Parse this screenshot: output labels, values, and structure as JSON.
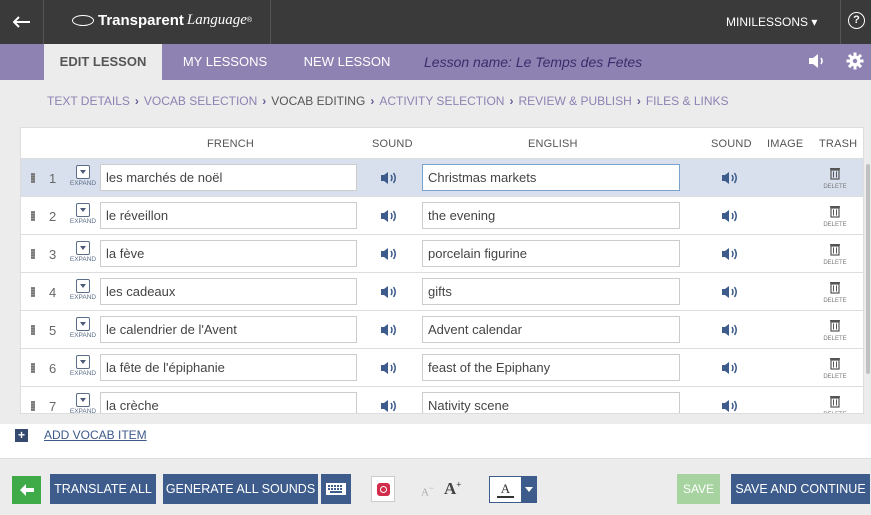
{
  "topbar": {
    "brand_bold": "Transparent",
    "brand_italic": "Language",
    "brand_mark": "®",
    "menu_label": "MINILESSONS",
    "menu_caret": "▾",
    "help_label": "?"
  },
  "tabs": [
    {
      "label": "EDIT LESSON",
      "active": true
    },
    {
      "label": "MY LESSONS",
      "active": false
    },
    {
      "label": "NEW LESSON",
      "active": false
    }
  ],
  "lesson_name": "Lesson name: Le Temps des Fetes",
  "breadcrumbs": [
    {
      "label": "TEXT DETAILS",
      "current": false
    },
    {
      "label": "VOCAB SELECTION",
      "current": false
    },
    {
      "label": "VOCAB EDITING",
      "current": true
    },
    {
      "label": "ACTIVITY SELECTION",
      "current": false
    },
    {
      "label": "REVIEW & PUBLISH",
      "current": false
    },
    {
      "label": "FILES & LINKS",
      "current": false
    }
  ],
  "breadcrumb_separator": "›",
  "table": {
    "headers": {
      "french": "FRENCH",
      "sound1": "SOUND",
      "english": "ENGLISH",
      "sound2": "SOUND",
      "image": "IMAGE",
      "trash": "TRASH"
    },
    "expand_label": "EXPAND",
    "delete_label": "DELETE",
    "rows": [
      {
        "num": "1",
        "french": "les marchés de noël",
        "english": "Christmas markets",
        "selected": true
      },
      {
        "num": "2",
        "french": "le réveillon",
        "english": "the evening",
        "selected": false
      },
      {
        "num": "3",
        "french": "la fève",
        "english": "porcelain figurine",
        "selected": false
      },
      {
        "num": "4",
        "french": "les cadeaux",
        "english": "gifts",
        "selected": false
      },
      {
        "num": "5",
        "french": "le calendrier de l'Avent",
        "english": "Advent calendar",
        "selected": false
      },
      {
        "num": "6",
        "french": "la fête de l'épiphanie",
        "english": "feast of the Epiphany",
        "selected": false
      },
      {
        "num": "7",
        "french": "la crèche",
        "english": "Nativity scene",
        "selected": false
      }
    ]
  },
  "add_item": {
    "icon": "+",
    "label": "ADD VOCAB ITEM"
  },
  "toolbar": {
    "translate_all": "TRANSLATE ALL",
    "generate_sounds": "GENERATE ALL SOUNDS",
    "font_decrease": "A",
    "font_decrease_sign": "−",
    "font_increase": "A",
    "font_increase_sign": "+",
    "text_color_label": "A",
    "save": "SAVE",
    "save_continue": "SAVE AND CONTINUE"
  },
  "colors": {
    "topbar": "#3a3a3a",
    "tabbar": "#8e82b3",
    "crumb_bg": "#ececec",
    "primary_button": "#3d5c8c",
    "back_green": "#3eab48",
    "save_disabled": "#a6d3a0",
    "record_red": "#d12c4a",
    "selected_row": "#d7e0ec"
  },
  "icons": {
    "back": "back-arrow-icon",
    "logo": "speech-oval-icon",
    "help": "help-circle-icon",
    "speaker": "speaker-icon",
    "settings": "gear-icon",
    "drag": "drag-handle-icon",
    "expand": "expand-dropdown-icon",
    "trash": "trash-can-icon",
    "keyboard": "keyboard-icon",
    "record": "record-icon"
  }
}
